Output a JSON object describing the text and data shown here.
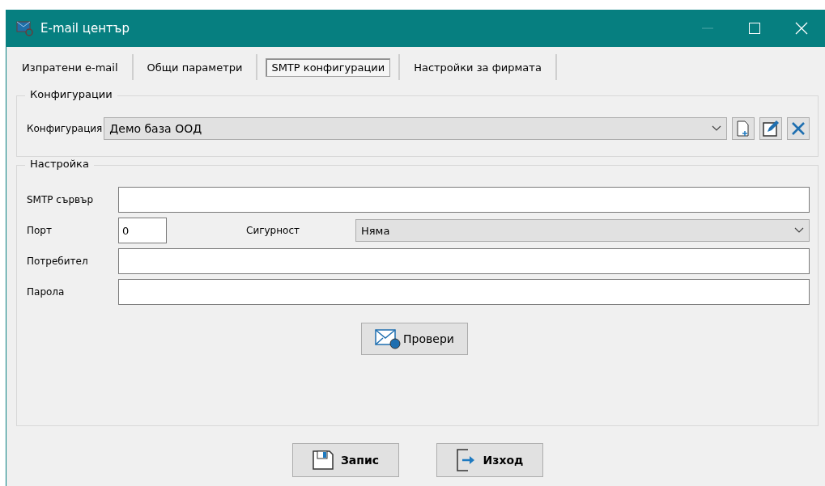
{
  "window": {
    "title": "E-mail център"
  },
  "tabs": [
    {
      "label": "Изпратени e-mail",
      "selected": false
    },
    {
      "label": "Общи параметри",
      "selected": false
    },
    {
      "label": "SMTP конфигурации",
      "selected": true
    },
    {
      "label": "Настройки за фирмата",
      "selected": false
    }
  ],
  "configurations": {
    "title": "Конфигурации",
    "label": "Конфигурация",
    "value": "Демо база ООД"
  },
  "settings": {
    "title": "Настройка",
    "smtp_server": {
      "label": "SMTP сървър"
    },
    "port": {
      "label": "Порт",
      "value": "0"
    },
    "security": {
      "label": "Сигурност",
      "value": "Няма"
    },
    "user": {
      "label": "Потребител"
    },
    "password": {
      "label": "Парола"
    },
    "check_button": "Провери"
  },
  "buttons": [
    {
      "kind": "save",
      "label": "Запис"
    },
    {
      "kind": "exit",
      "label": "Изход"
    }
  ]
}
